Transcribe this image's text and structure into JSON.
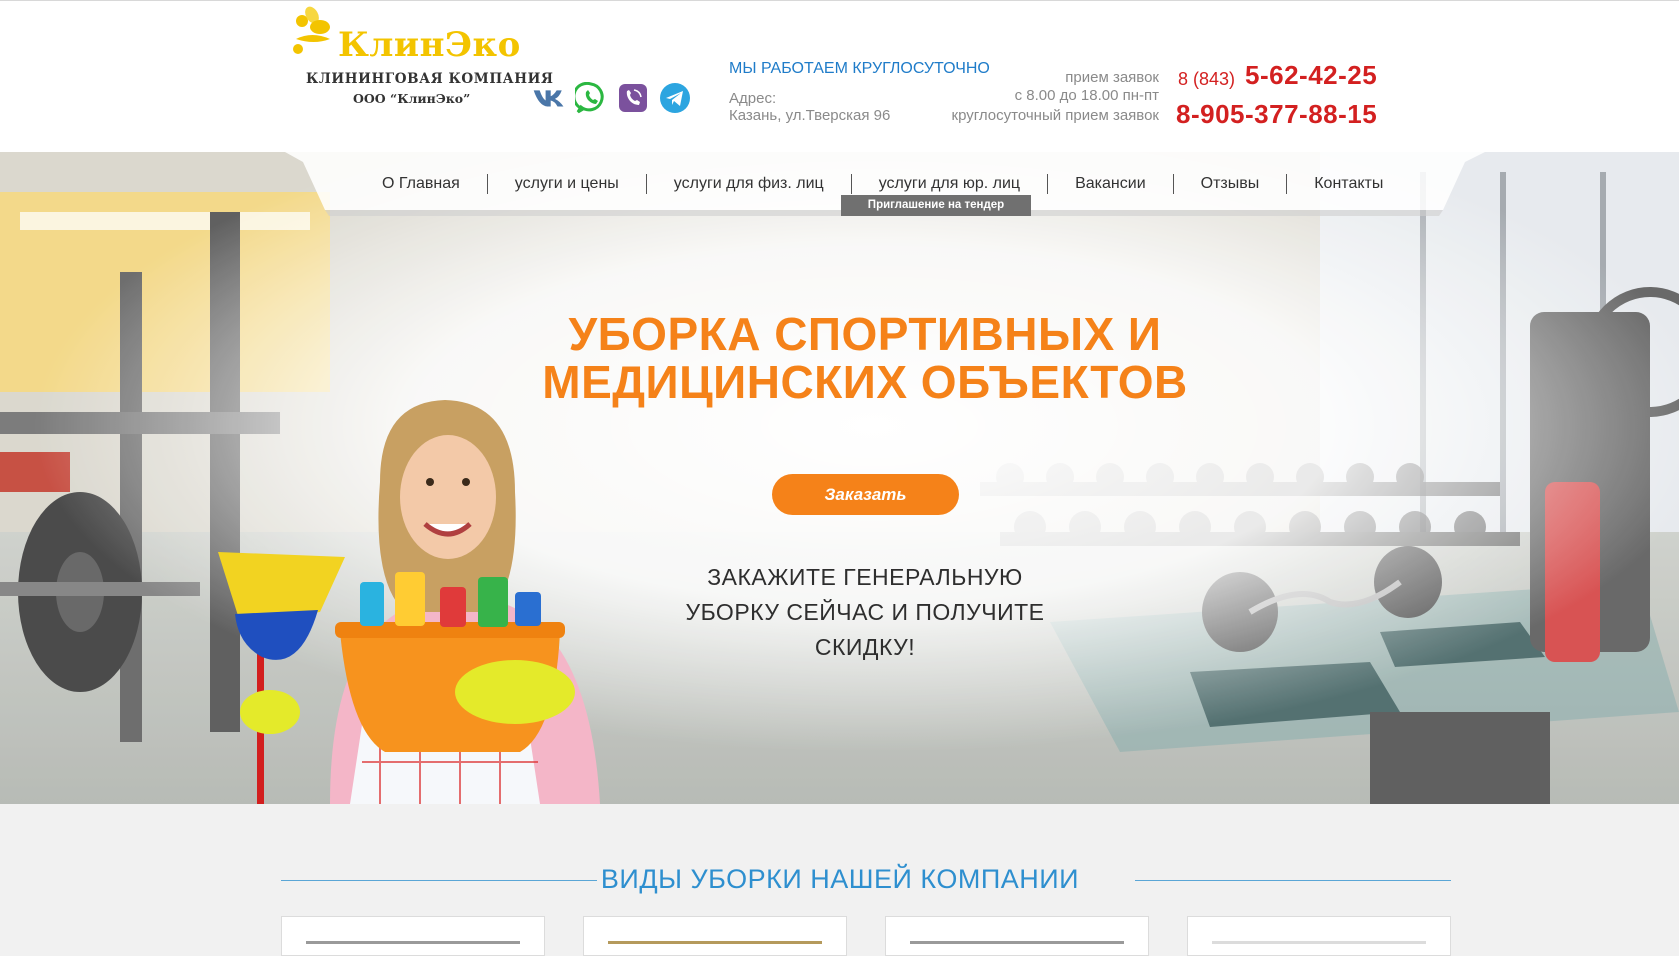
{
  "logo": {
    "name": "КлинЭко",
    "subtitle": "КЛИНИНГОВАЯ КОМПАНИЯ",
    "company": "ООО “КлинЭко”"
  },
  "social": [
    {
      "icon": "vk-icon",
      "color": "#4a76a8"
    },
    {
      "icon": "whatsapp-icon",
      "color": "#2bb741"
    },
    {
      "icon": "viber-icon",
      "color": "#7b519d"
    },
    {
      "icon": "telegram-icon",
      "color": "#2ca5e0"
    }
  ],
  "contacts": {
    "work_hours": "МЫ РАБОТАЕМ КРУГЛОСУТОЧНО",
    "address_label": "Адрес:",
    "address": "Казань, ул.Тверская 96",
    "reception_label": "прием заявок",
    "reception_hours": "с 8.00 до 18.00 пн-пт",
    "round_clock_label": "круглосуточный прием заявок",
    "phone_code": "8 (843)",
    "phone_number": "5-62-42-25",
    "mobile": "8-905-377-88-15"
  },
  "nav": {
    "items": [
      "О Главная",
      "услуги и цены",
      "услуги для физ. лиц",
      "услуги для юр. лиц",
      "Вакансии",
      "Отзывы",
      "Контакты"
    ],
    "submenu": "Приглашение на тендер"
  },
  "hero": {
    "title_line1": "УБОРКА СПОРТИВНЫХ И",
    "title_line2": "МЕДИЦИНСКИХ ОБЪЕКТОВ",
    "button": "Заказать",
    "promo_line1": "ЗАКАЖИТЕ ГЕНЕРАЛЬНУЮ",
    "promo_line2": "УБОРКУ СЕЙЧАС И ПОЛУЧИТЕ",
    "promo_line3": "СКИДКУ!"
  },
  "section": {
    "title": "ВИДЫ УБОРКИ НАШЕЙ КОМПАНИИ"
  },
  "colors": {
    "accent_orange": "#f58219",
    "phone_red": "#d32020",
    "link_blue": "#1f7cc9",
    "logo_yellow": "#f3c400"
  }
}
